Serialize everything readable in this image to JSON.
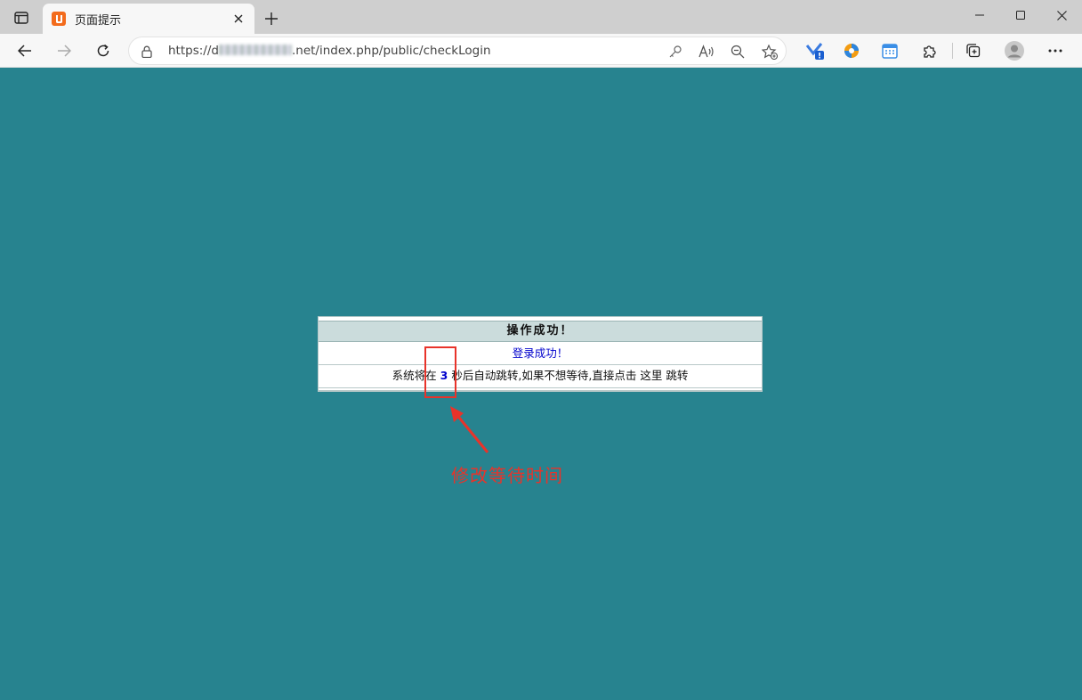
{
  "browser": {
    "tab": {
      "title": "页面提示",
      "favicon": "bookmark-favicon-icon"
    },
    "address": {
      "prefix": "https://",
      "obscured_host_start": "d",
      "host_suffix": ".net",
      "path": "/index.php/public/checkLogin"
    }
  },
  "message": {
    "heading": "操作成功！",
    "success_text": "登录成功！",
    "redirect_before": "系统将在",
    "countdown": "3",
    "redirect_after": "秒后自动跳转,如果不想等待,直接点击",
    "link_text": "这里",
    "redirect_end": "跳转"
  },
  "annotation": {
    "label": "修改等待时间",
    "color": "#e8332a"
  },
  "colors": {
    "page_background": "#27838f",
    "header_background": "#cbdcdc",
    "link_blue": "#0000cc"
  }
}
